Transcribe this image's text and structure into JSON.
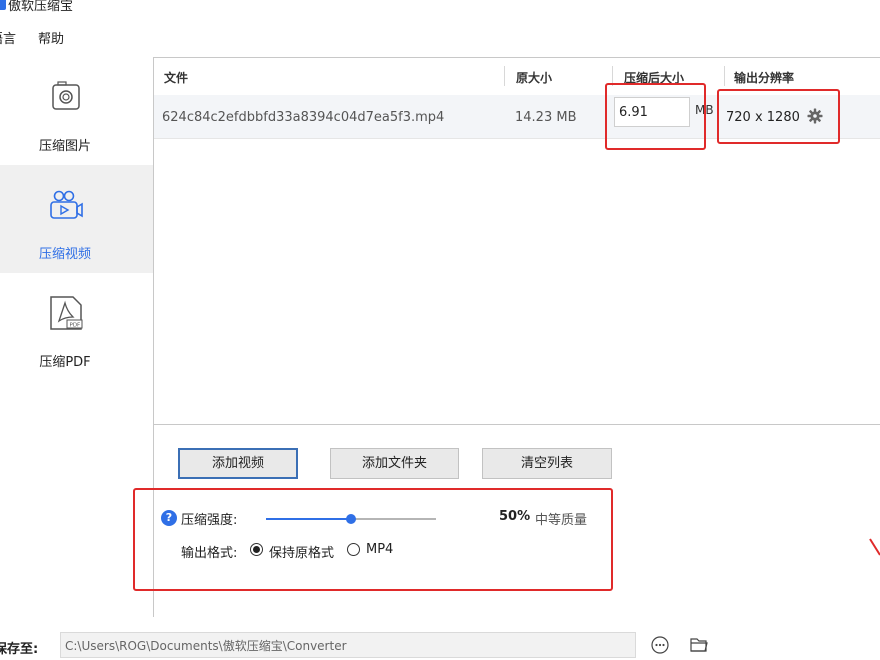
{
  "app": {
    "title": "傲软压缩宝"
  },
  "menu": {
    "items": [
      "语言",
      "帮助"
    ]
  },
  "sidebar": {
    "items": [
      {
        "label": "压缩图片",
        "icon": "camera-icon",
        "active": false
      },
      {
        "label": "压缩视频",
        "icon": "video-camera-icon",
        "active": true
      },
      {
        "label": "压缩PDF",
        "icon": "pdf-icon",
        "active": false
      }
    ]
  },
  "table": {
    "columns": {
      "file": "文件",
      "original": "原大小",
      "compressed": "压缩后大小",
      "resolution": "输出分辨率"
    },
    "rows": [
      {
        "file": "624c84c2efdbbfd33a8394c04d7ea5f3.mp4",
        "original": "14.23 MB",
        "compressed_value": "6.91",
        "unit": "MB",
        "resolution": "720 x 1280"
      }
    ]
  },
  "buttons": {
    "add_video": "添加视频",
    "add_folder": "添加文件夹",
    "clear_list": "清空列表"
  },
  "compression": {
    "strength_label": "压缩强度:",
    "strength_value": "50%",
    "strength_percent": 50,
    "quality": "中等质量",
    "format_label": "输出格式:",
    "format_options": [
      "保持原格式",
      "MP4"
    ],
    "format_selected": "保持原格式"
  },
  "save": {
    "label": "保存至:",
    "path": "C:\\Users\\ROG\\Documents\\傲软压缩宝\\Converter"
  },
  "colors": {
    "accent": "#2f6fe6",
    "highlight": "#e02a2a",
    "sidebar_active": "#f0f0f0"
  }
}
